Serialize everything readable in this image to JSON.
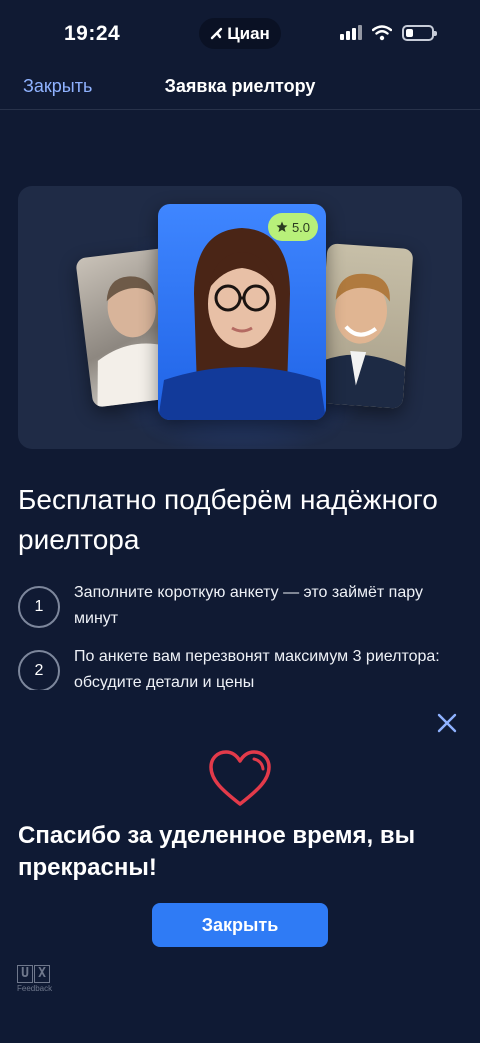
{
  "status_bar": {
    "time": "19:24",
    "app_badge": "Циан",
    "icons": [
      "signal-icon",
      "wifi-icon",
      "battery-icon"
    ],
    "battery_level": 0.3
  },
  "nav": {
    "close_label": "Закрыть",
    "title": "Заявка риелтору"
  },
  "hero": {
    "rating": "5.0",
    "photos": [
      "realtor-photo-left",
      "realtor-photo-center",
      "realtor-photo-right"
    ]
  },
  "headline": "Бесплатно подберём надёжного риелтора",
  "steps": [
    {
      "number": "1",
      "text": "Заполните короткую анкету — это займёт пару минут"
    },
    {
      "number": "2",
      "text": "По анкете вам перезвонят максимум 3 риелтора: обсудите детали и цены"
    }
  ],
  "feedback_sheet": {
    "title": "Спасибо за уделенное время, вы прекрасны!",
    "button_label": "Закрыть",
    "brand_letters": "UX",
    "brand_caption": "Feedback"
  },
  "colors": {
    "background": "#101a33",
    "accent_blue": "#2f7bf5",
    "link_blue": "#8fb2ff",
    "heart_red": "#e23a4a",
    "rating_badge": "#b8f07a"
  }
}
